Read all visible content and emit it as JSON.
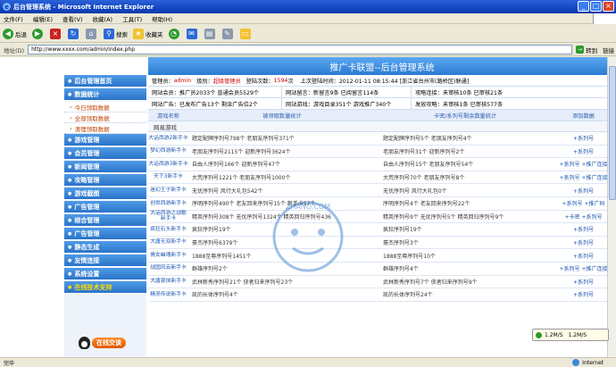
{
  "window": {
    "title": "后台管理系统 - Microsoft Internet Explorer"
  },
  "menu": [
    "文件(F)",
    "编辑(E)",
    "查看(V)",
    "收藏(A)",
    "工具(T)",
    "帮助(H)"
  ],
  "toolbar": {
    "back": "后退",
    "search": "搜索",
    "favorites": "收藏夹"
  },
  "address": {
    "label": "地址(D)",
    "url": "http://www.xxxx.com/admin/index.php",
    "go": "转到",
    "links": "链接"
  },
  "banner": "推广卡联盟--后台管理系统",
  "sidebar": {
    "items": [
      {
        "label": "后台管理首页"
      },
      {
        "label": "数据统计"
      },
      {
        "label": "今日领取数据",
        "sub": true
      },
      {
        "label": "全部领取数据",
        "sub": true
      },
      {
        "label": "清理领取数据",
        "sub": true
      },
      {
        "label": "游戏管理"
      },
      {
        "label": "会员管理"
      },
      {
        "label": "新闻管理"
      },
      {
        "label": "攻略管理"
      },
      {
        "label": "游戏截图"
      },
      {
        "label": "广告管理"
      },
      {
        "label": "综合管理"
      },
      {
        "label": "广告管理"
      },
      {
        "label": "静态生成"
      },
      {
        "label": "友情连接"
      },
      {
        "label": "系统设置"
      },
      {
        "label": "在线技术支持",
        "highlight": true
      }
    ],
    "service_button": "在线交谈"
  },
  "user_info": {
    "prefix": "管理员：",
    "name": "admin",
    "level_prefix": "级别：",
    "level": "超级管理员",
    "login_prefix": "登陆次数：",
    "login_count": "1594",
    "login_suffix": "次",
    "last_login": "上次登陆时间：2012-01-11  08:15:44 [浙江省台州市(路桥区)联通]"
  },
  "stats": {
    "row1": [
      "网站会员：推广员2033个  普通会员5529个",
      "网站留言：新留言9条  已阅留言114条",
      "攻略连接：未审核10条  已审核21条"
    ],
    "row2": [
      "网站广告：已发布广告13个  剩余广告位2个",
      "网站游戏：游戏目录351个  游戏推广340个",
      "发放攻略：未审核1条  已审核577条"
    ]
  },
  "table": {
    "headers": [
      "游戏名称",
      "被领取数量统计",
      "卡密/系列号剩余数量统计",
      "添加数据"
    ],
    "section": "网易游戏",
    "rows": [
      {
        "name": "大话西游2新手卡",
        "left": "题定配牌序列号798个  老朋友序列号371个",
        "mid": "题定配牌序列号5个  老朋友序列号4个",
        "action": "+系列号"
      },
      {
        "name": "梦幻西游新手卡",
        "left": "老朋友序列号2115个  迎新序列号3624个",
        "mid": "老朋友序列号31个  迎新序列号2个",
        "action": "+系列号"
      },
      {
        "name": "大话西游3新手卡",
        "left": "自由人序列号166个  迎新序列号47个",
        "mid": "自由人序列号15个  老朋友序列号54个",
        "action": "+系列号  +推广连接"
      },
      {
        "name": "天下3新手卡",
        "left": "大荒序列号1221个  老朋友序列号1000个",
        "mid": "大荒序列号70个  老朋友序列号8个",
        "action": "+系列号  +推广连接"
      },
      {
        "name": "迷幻王子新手卡",
        "left": "无优序列号  风行大礼包542个",
        "mid": "无优序列号  风行大礼包0个",
        "action": "+系列号"
      },
      {
        "name": "创世西游新手卡",
        "left": "序明序列号490个  老友回来序列号15个  新手卡57个",
        "mid": "序明序列号4个  老友回来序列号22个",
        "action": "+系列号  +推广码"
      },
      {
        "name": "大话西游之战歌新手卡",
        "left": "精英序列号308个  无优序列号1324个  精英回归序列号436",
        "mid": "精英序列号9个  无优序列号5个  精英回归序列号9个",
        "action": "+卡密  +系列号"
      },
      {
        "name": "疯狂石头新手卡",
        "left": "疯狂序列号19个",
        "mid": "疯狂序列号19个",
        "action": "+系列号"
      },
      {
        "name": "大唐无双新手卡",
        "left": "豪杰序列号6379个",
        "mid": "豪杰序列号3个",
        "action": "+系列号"
      },
      {
        "name": "倩女幽魂新手卡",
        "left": "1888至尊序列号1451个",
        "mid": "1888至尊序列号10个",
        "action": "+系列号"
      },
      {
        "name": "战国风云新手卡",
        "left": "群雄序列号2个",
        "mid": "群雄序列号4个",
        "action": "+系列号  +推广连接"
      },
      {
        "name": "大唐豪侠新手卡",
        "left": "武林新秀序列号21个  侠者归来序列号23个",
        "mid": "武林新秀序列号7个  侠者归来序列号9个",
        "action": "+系列号"
      },
      {
        "name": "精灵传说新手卡",
        "left": "凯的长体序列号4个",
        "mid": "凯的长体序列号24个",
        "action": "+系列号"
      }
    ]
  },
  "watermark": "ZHANO.COM",
  "speed": [
    "1.2M/S",
    "1.2M/S"
  ],
  "status": {
    "left": "完毕",
    "zone": "Internet"
  },
  "colors": {
    "nav": "#2a73c9",
    "banner": "#2a7bd2",
    "alert": "#d00000"
  }
}
